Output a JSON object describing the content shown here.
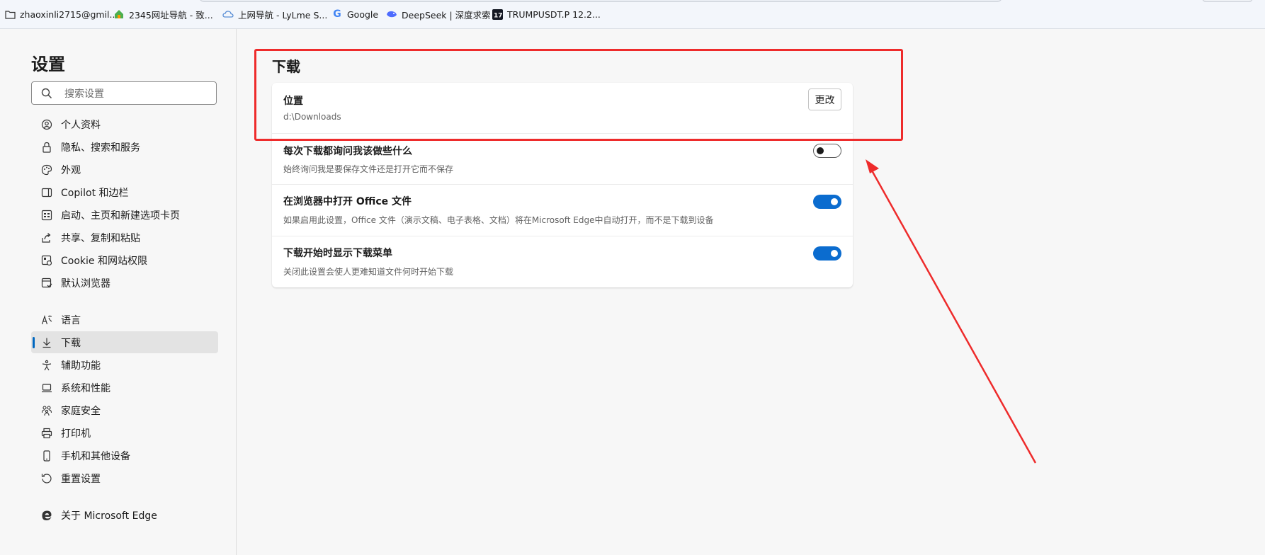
{
  "bookmarks": [
    {
      "label": "zhaoxinli2715@gmil...",
      "icon": "folder-icon"
    },
    {
      "label": "2345网址导航 - 致...",
      "icon": "house-logo-icon"
    },
    {
      "label": "上网导航 - LyLme S...",
      "icon": "cloud-icon"
    },
    {
      "label": "Google",
      "icon": "google-icon"
    },
    {
      "label": "DeepSeek | 深度求索",
      "icon": "deepseek-whale-icon"
    },
    {
      "label": "TRUMPUSDT.P 12.2...",
      "icon": "tradingview-icon"
    }
  ],
  "sidebar": {
    "title": "设置",
    "search_placeholder": "搜索设置",
    "items": [
      {
        "label": "个人资料",
        "icon": "profile-icon"
      },
      {
        "label": "隐私、搜索和服务",
        "icon": "lock-icon"
      },
      {
        "label": "外观",
        "icon": "palette-icon"
      },
      {
        "label": "Copilot 和边栏",
        "icon": "sidebar-panel-icon"
      },
      {
        "label": "启动、主页和新建选项卡页",
        "icon": "home-grid-icon"
      },
      {
        "label": "共享、复制和粘贴",
        "icon": "share-icon"
      },
      {
        "label": "Cookie 和网站权限",
        "icon": "site-permissions-icon"
      },
      {
        "label": "默认浏览器",
        "icon": "default-browser-icon"
      },
      {
        "label": "语言",
        "icon": "language-icon"
      },
      {
        "label": "下载",
        "icon": "download-icon",
        "active": true
      },
      {
        "label": "辅助功能",
        "icon": "accessibility-icon"
      },
      {
        "label": "系统和性能",
        "icon": "laptop-icon"
      },
      {
        "label": "家庭安全",
        "icon": "family-icon"
      },
      {
        "label": "打印机",
        "icon": "printer-icon"
      },
      {
        "label": "手机和其他设备",
        "icon": "phone-icon"
      },
      {
        "label": "重置设置",
        "icon": "reset-icon"
      },
      {
        "label": "关于 Microsoft Edge",
        "icon": "edge-logo-icon"
      }
    ]
  },
  "main": {
    "section_title": "下载",
    "location": {
      "title": "位置",
      "path": "d:\\Downloads",
      "button": "更改"
    },
    "settings": [
      {
        "title": "每次下载都询问我该做些什么",
        "desc": "始终询问我是要保存文件还是打开它而不保存",
        "enabled": false
      },
      {
        "title": "在浏览器中打开 Office 文件",
        "desc": "如果启用此设置，Office 文件（演示文稿、电子表格、文档）将在Microsoft Edge中自动打开，而不是下载到设备",
        "enabled": true
      },
      {
        "title": "下载开始时显示下载菜单",
        "desc": "关闭此设置会使人更难知道文件何时开始下载",
        "enabled": true
      }
    ]
  },
  "colors": {
    "accent": "#0b6ccf",
    "annotation": "#ee2b2b"
  }
}
